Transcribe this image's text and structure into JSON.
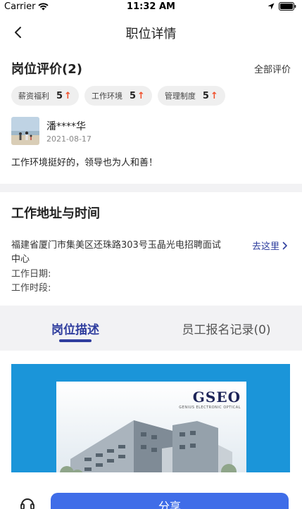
{
  "status_bar": {
    "carrier": "Carrier",
    "time": "11:32 AM"
  },
  "nav": {
    "title": "职位详情"
  },
  "reviews": {
    "title": "岗位评价(2)",
    "all_label": "全部评价",
    "tags": [
      {
        "label": "薪资福利",
        "score": "5"
      },
      {
        "label": "工作环境",
        "score": "5"
      },
      {
        "label": "管理制度",
        "score": "5"
      }
    ],
    "reviewer": {
      "name": "潘****华",
      "date": "2021-08-17"
    },
    "text": "工作环境挺好的，领导也为人和善！"
  },
  "address": {
    "title": "工作地址与时间",
    "location": "福建省厦门市集美区还珠路303号玉晶光电招聘面试中心",
    "goto_label": "去这里",
    "work_date_label": "工作日期:",
    "work_time_label": "工作时段:"
  },
  "tabs": [
    {
      "label": "岗位描述",
      "active": true
    },
    {
      "label": "员工报名记录(0)",
      "active": false
    }
  ],
  "image": {
    "brand": "GSEO",
    "brand_sub": "GENIUS ELECTRONIC OPTICAL"
  },
  "bottom": {
    "share_label": "分享"
  },
  "colors": {
    "accent": "#2f3d9e",
    "share_button": "#3f6de8",
    "arrow_up": "#f0502c",
    "banner_blue": "#1b95d9"
  }
}
